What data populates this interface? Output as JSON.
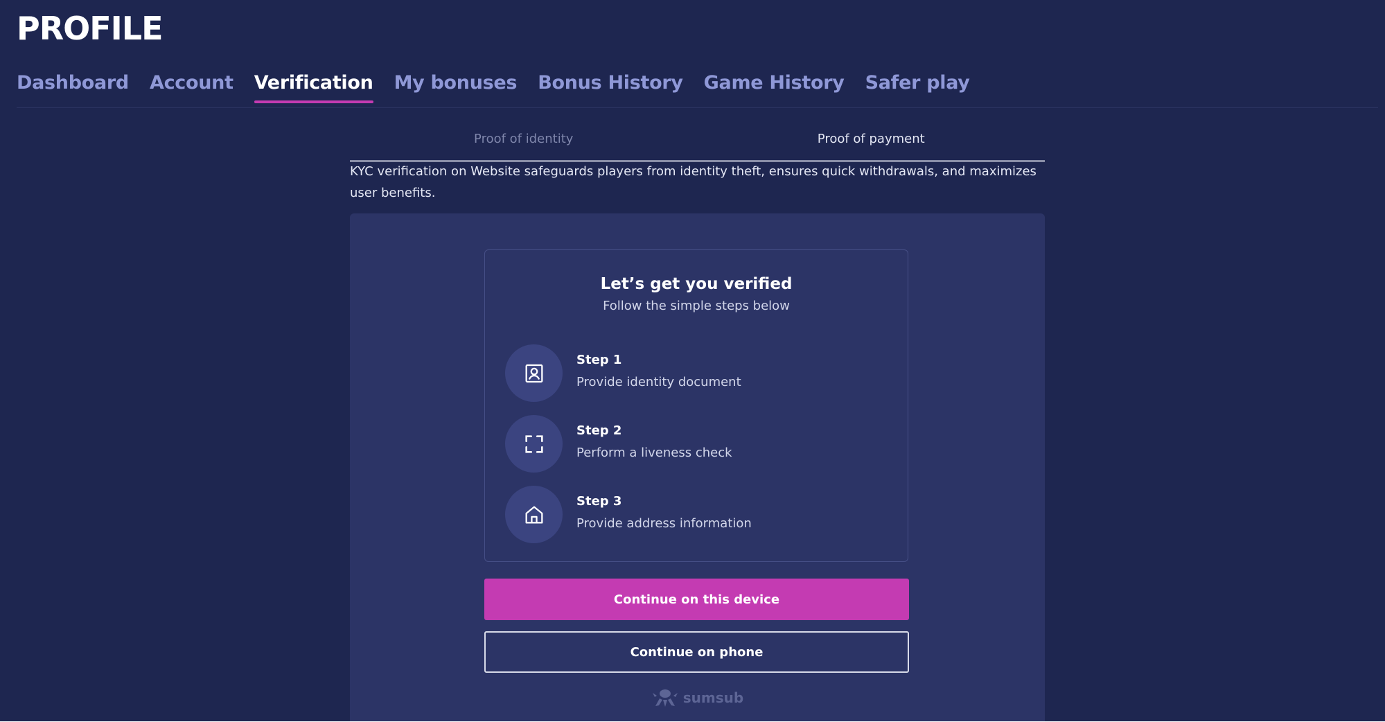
{
  "header": {
    "title": "PROFILE"
  },
  "nav": {
    "tabs": [
      {
        "label": "Dashboard"
      },
      {
        "label": "Account"
      },
      {
        "label": "Verification",
        "active": true
      },
      {
        "label": "My bonuses"
      },
      {
        "label": "Bonus History"
      },
      {
        "label": "Game History"
      },
      {
        "label": "Safer play"
      }
    ]
  },
  "verification": {
    "sub_tabs": [
      {
        "label": "Proof of identity"
      },
      {
        "label": "Proof of payment",
        "selected": true
      }
    ],
    "intro": "KYC verification on Website safeguards players from identity theft, ensures quick withdrawals, and maximizes user benefits.",
    "card": {
      "title": "Let’s get you verified",
      "subtitle": "Follow the simple steps below",
      "steps": [
        {
          "title": "Step 1",
          "description": "Provide identity document",
          "icon": "id-card-icon"
        },
        {
          "title": "Step 2",
          "description": "Perform a liveness check",
          "icon": "face-scan-icon"
        },
        {
          "title": "Step 3",
          "description": "Provide address information",
          "icon": "home-icon"
        }
      ]
    },
    "buttons": {
      "primary": "Continue on this device",
      "secondary": "Continue on phone"
    },
    "powered_by": "sumsub"
  },
  "colors": {
    "background": "#1e2650",
    "panel": "#2c3466",
    "accent": "#c43bb2",
    "tab_inactive": "#8f98d7"
  }
}
